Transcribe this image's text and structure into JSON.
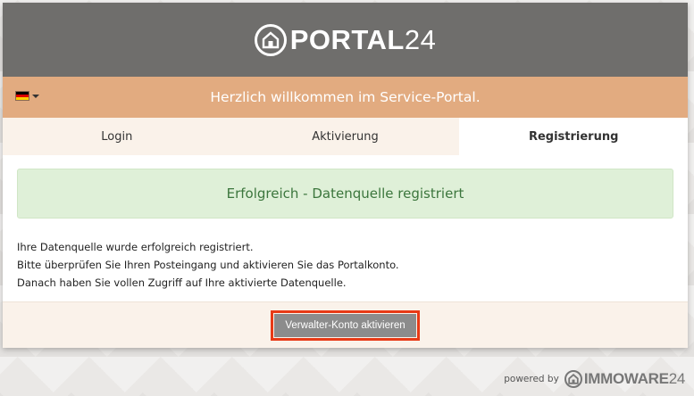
{
  "header": {
    "logo_text": "PORTAL",
    "logo_num": "24"
  },
  "welcome_bar": {
    "text": "Herzlich willkommen im Service-Portal.",
    "language_flag": "flag-germany",
    "flag_colors": [
      "#000000",
      "#dd0000",
      "#ffce00"
    ]
  },
  "tabs": [
    {
      "label": "Login",
      "active": false
    },
    {
      "label": "Aktivierung",
      "active": false
    },
    {
      "label": "Registrierung",
      "active": true
    }
  ],
  "alert": {
    "text": "Erfolgreich - Datenquelle registriert"
  },
  "message": {
    "line1": "Ihre Datenquelle wurde erfolgreich registriert.",
    "line2": "Bitte überprüfen Sie Ihren Posteingang und aktivieren Sie das Portalkonto.",
    "line3": "Danach haben Sie vollen Zugriff auf Ihre aktivierte Datenquelle."
  },
  "footer": {
    "button_label": "Verwalter-Konto aktivieren"
  },
  "powered": {
    "label": "powered by",
    "brand_text": "IMMOWARE",
    "brand_num": "24"
  },
  "colors": {
    "header_bg": "#6f6e6c",
    "welcome_bg": "#e2ab80",
    "alert_bg": "#dff0d8",
    "alert_text": "#3c763d",
    "button_bg": "#8c8c8c",
    "highlight": "#e83a16"
  }
}
